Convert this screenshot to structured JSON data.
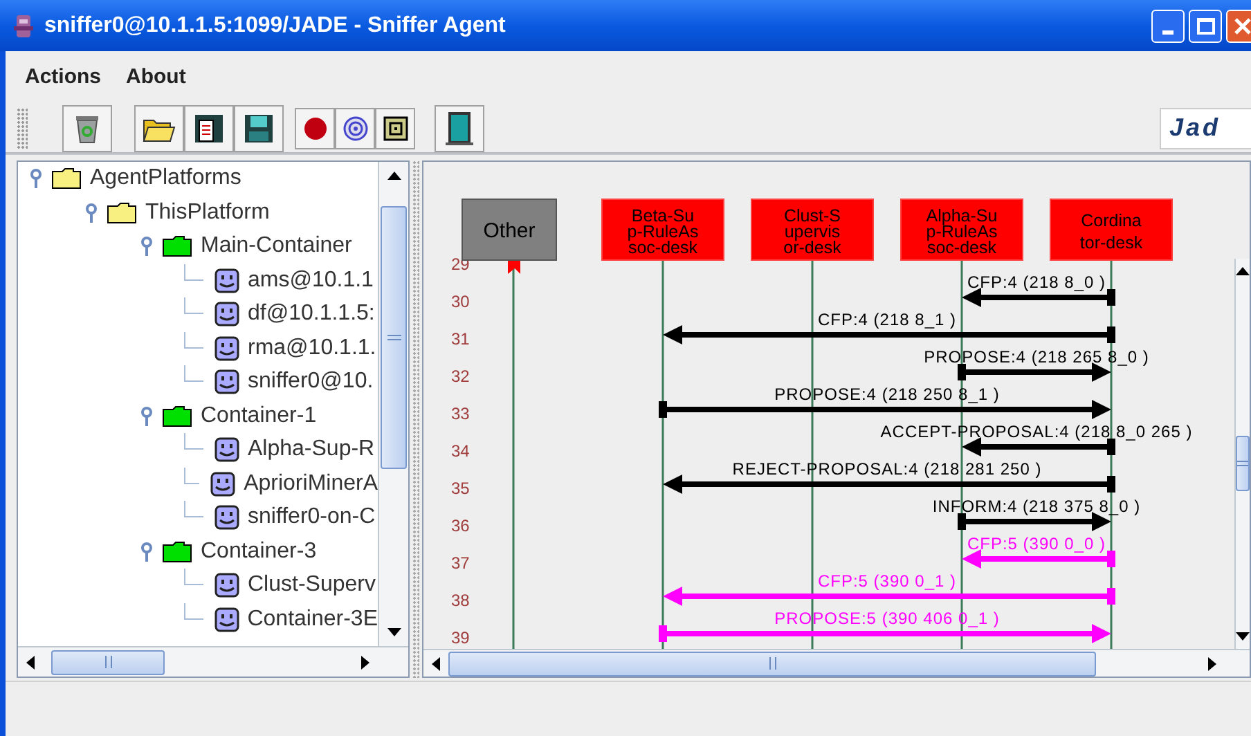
{
  "window": {
    "title": "sniffer0@10.1.1.5:1099/JADE - Sniffer Agent"
  },
  "menu": [
    "Actions",
    "About"
  ],
  "toolbar": {
    "logo": "Jad"
  },
  "tree": {
    "root": {
      "label": "AgentPlatforms",
      "kind": "platform",
      "expanded": true,
      "children": [
        {
          "label": "ThisPlatform",
          "kind": "platform",
          "expanded": true,
          "children": [
            {
              "label": "Main-Container",
              "kind": "container",
              "expanded": true,
              "children": [
                {
                  "label": "ams@10.1.1",
                  "kind": "agent"
                },
                {
                  "label": "df@10.1.1.5:",
                  "kind": "agent"
                },
                {
                  "label": "rma@10.1.1.",
                  "kind": "agent"
                },
                {
                  "label": "sniffer0@10.",
                  "kind": "agent"
                }
              ]
            },
            {
              "label": "Container-1",
              "kind": "container",
              "expanded": true,
              "children": [
                {
                  "label": "Alpha-Sup-R",
                  "kind": "agent"
                },
                {
                  "label": "AprioriMinerA",
                  "kind": "agent"
                },
                {
                  "label": "sniffer0-on-C",
                  "kind": "agent"
                }
              ]
            },
            {
              "label": "Container-3",
              "kind": "container",
              "expanded": true,
              "children": [
                {
                  "label": "Clust-Superv",
                  "kind": "agent"
                },
                {
                  "label": "Container-3E",
                  "kind": "agent"
                }
              ]
            }
          ]
        }
      ]
    }
  },
  "agents": [
    {
      "lines": [
        "Other"
      ],
      "kind": "other"
    },
    {
      "lines": [
        "Beta-Su",
        "p-RuleAs",
        "soc-desk"
      ],
      "kind": "agent"
    },
    {
      "lines": [
        "Clust-S",
        "upervis",
        "or-desk"
      ],
      "kind": "agent"
    },
    {
      "lines": [
        "Alpha-Su",
        "p-RuleAs",
        "soc-desk"
      ],
      "kind": "agent"
    },
    {
      "lines": [
        "Cordina",
        "tor-desk"
      ],
      "kind": "agent"
    }
  ],
  "rows": [
    {
      "number": "29"
    },
    {
      "number": "30",
      "message": {
        "label": "CFP:4 (218  8_0   )",
        "color": "#000000"
      }
    },
    {
      "number": "31",
      "message": {
        "label": "CFP:4 (218  8_1   )",
        "color": "#000000"
      }
    },
    {
      "number": "32",
      "message": {
        "label": "PROPOSE:4 (218  265  8_0 )",
        "color": "#000000"
      }
    },
    {
      "number": "33",
      "message": {
        "label": "PROPOSE:4 (218  250  8_1 )",
        "color": "#000000"
      }
    },
    {
      "number": "34",
      "message": {
        "label": "ACCEPT-PROPOSAL:4 (218  8_0  265 )",
        "color": "#000000"
      }
    },
    {
      "number": "35",
      "message": {
        "label": "REJECT-PROPOSAL:4 (218  281  250 )",
        "color": "#000000"
      }
    },
    {
      "number": "36",
      "message": {
        "label": "INFORM:4 (218  375  8_0 )",
        "color": "#000000"
      }
    },
    {
      "number": "37",
      "message": {
        "label": "CFP:5 (390  0_0   )",
        "color": "#ff00ff"
      }
    },
    {
      "number": "38",
      "message": {
        "label": "CFP:5 (390  0_1   )",
        "color": "#ff00ff"
      }
    },
    {
      "number": "39",
      "message": {
        "label": "PROPOSE:5 (390  406  0_1 )",
        "color": "#ff00ff"
      }
    }
  ]
}
